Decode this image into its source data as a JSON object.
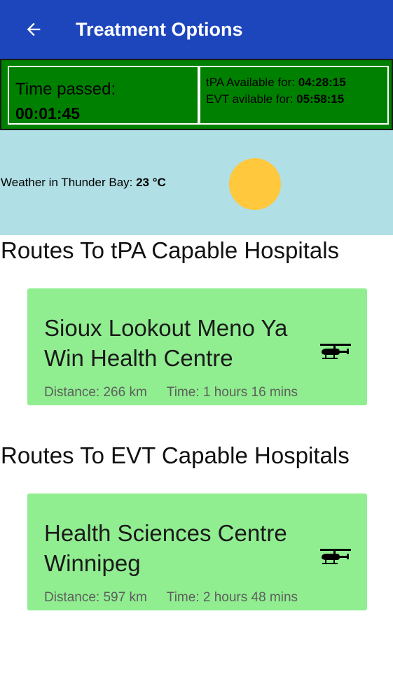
{
  "appbar": {
    "title": "Treatment Options",
    "back_icon": "arrow-left-icon"
  },
  "timers": {
    "elapsed_label": "Time passed:",
    "elapsed_value": "00:01:45",
    "tpa_label": "tPA Available for: ",
    "tpa_value": "04:28:15",
    "evt_label": "EVT avilable for: ",
    "evt_value": "05:58:15"
  },
  "weather": {
    "label": "Weather in Thunder Bay: ",
    "value": "23 °C",
    "icon": "sun-icon"
  },
  "sections": {
    "tpa": {
      "heading": "Routes To tPA Capable Hospitals",
      "hospital": {
        "name": "Sioux Lookout Meno Ya Win Health Centre",
        "distance": "Distance: 266 km",
        "time": "Time: 1 hours 16 mins",
        "transport_icon": "helicopter-icon"
      }
    },
    "evt": {
      "heading": "Routes To EVT Capable Hospitals",
      "hospital": {
        "name": "Health Sciences Centre Winnipeg",
        "distance": "Distance: 597 km",
        "time": "Time: 2 hours 48 mins",
        "transport_icon": "helicopter-icon"
      }
    }
  },
  "colors": {
    "appbar": "#1d46bd",
    "timer_panel": "#008000",
    "weather_bg": "#b0dfe5",
    "sun": "#ffc83d",
    "card": "#90ee90"
  }
}
